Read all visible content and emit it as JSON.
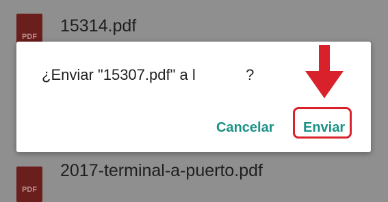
{
  "background_list": {
    "files": [
      {
        "name": "15314.pdf",
        "icon": "pdf-icon",
        "icon_text": "PDF"
      },
      {
        "name": "2017-terminal-a-puerto.pdf",
        "icon": "pdf-icon",
        "icon_text": "PDF"
      }
    ]
  },
  "dialog": {
    "message": "¿Enviar \"15307.pdf\" a l            ?",
    "cancel_label": "Cancelar",
    "send_label": "Enviar"
  },
  "annotation": {
    "color": "#d8212a",
    "icon": "arrow-down-icon"
  },
  "colors": {
    "accent": "#1a9185",
    "scrim": "#8f8f8f",
    "dialog_bg": "#ffffff"
  }
}
